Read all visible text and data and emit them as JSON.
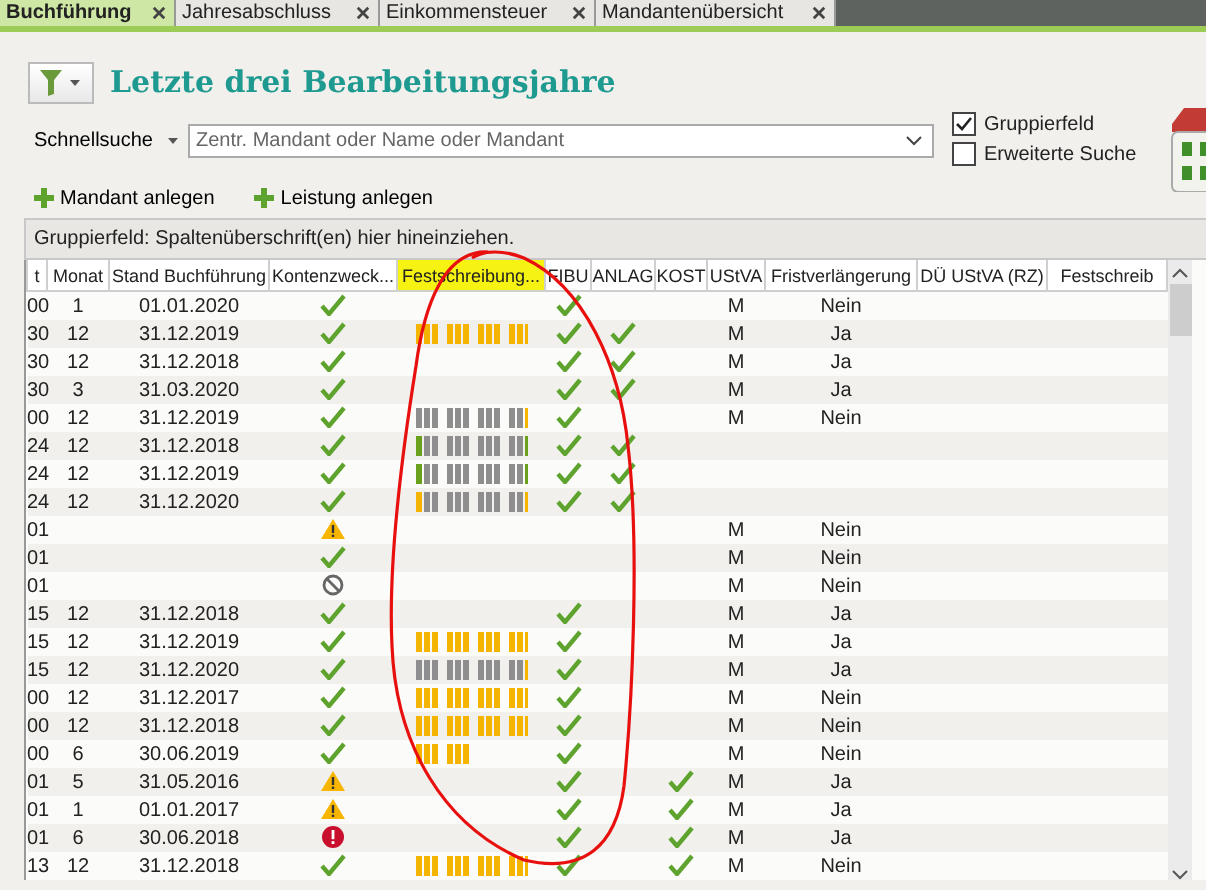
{
  "tabs": [
    {
      "label": "Buchführung",
      "selected": true
    },
    {
      "label": "Jahresabschluss",
      "selected": false
    },
    {
      "label": "Einkommensteuer",
      "selected": false
    },
    {
      "label": "Mandantenübersicht",
      "selected": false
    }
  ],
  "title": "Letzte drei Bearbeitungsjahre",
  "search": {
    "label": "Schnellsuche",
    "placeholder": "Zentr. Mandant oder Name oder Mandant"
  },
  "options": [
    {
      "label": "Gruppierfeld",
      "checked": true
    },
    {
      "label": "Erweiterte Suche",
      "checked": false
    }
  ],
  "actions": [
    "Mandant anlegen",
    "Leistung anlegen"
  ],
  "group_panel": "Gruppierfeld: Spaltenüberschrift(en) hier hineinziehen.",
  "columns": [
    {
      "label": "t",
      "highlighted": false
    },
    {
      "label": "Monat",
      "highlighted": false
    },
    {
      "label": "Stand Buchführung",
      "highlighted": false
    },
    {
      "label": "Kontenzweck...",
      "highlighted": false
    },
    {
      "label": "Festschreibung...",
      "highlighted": true
    },
    {
      "label": "FIBU",
      "highlighted": false
    },
    {
      "label": "ANLAG",
      "highlighted": false
    },
    {
      "label": "KOST",
      "highlighted": false
    },
    {
      "label": "UStVA",
      "highlighted": false
    },
    {
      "label": "Fristverlängerung",
      "highlighted": false
    },
    {
      "label": "DÜ UStVA (RZ)",
      "highlighted": false
    },
    {
      "label": "Festschreib",
      "highlighted": false
    }
  ],
  "rows": [
    {
      "c0": "00",
      "monat": "1",
      "stand": "01.01.2020",
      "konten": {
        "kind": "check"
      },
      "fibu": true,
      "anlag": false,
      "kost": false,
      "ustva": "M",
      "frist": "Nein"
    },
    {
      "c0": "30",
      "monat": "12",
      "stand": "31.12.2019",
      "konten": {
        "kind": "check"
      },
      "bars": [
        {
          "kind": "open"
        },
        {
          "kind": "open"
        },
        {
          "kind": "open"
        },
        {
          "kind": "open"
        },
        {
          "kind": "open"
        },
        {
          "kind": "open"
        },
        {
          "kind": "open"
        },
        {
          "kind": "open"
        },
        {
          "kind": "open"
        },
        {
          "kind": "open"
        },
        {
          "kind": "open"
        },
        {
          "kind": "open"
        }
      ],
      "fibu": true,
      "anlag": true,
      "kost": false,
      "ustva": "M",
      "frist": "Ja"
    },
    {
      "c0": "30",
      "monat": "12",
      "stand": "31.12.2018",
      "konten": {
        "kind": "check"
      },
      "fibu": true,
      "anlag": true,
      "kost": false,
      "ustva": "M",
      "frist": "Ja"
    },
    {
      "c0": "30",
      "monat": "3",
      "stand": "31.03.2020",
      "konten": {
        "kind": "check"
      },
      "fibu": true,
      "anlag": true,
      "kost": false,
      "ustva": "M",
      "frist": "Ja"
    },
    {
      "c0": "00",
      "monat": "12",
      "stand": "31.12.2019",
      "konten": {
        "kind": "check"
      },
      "bars": [
        {
          "kind": "locked"
        },
        {
          "kind": "locked"
        },
        {
          "kind": "locked"
        },
        {
          "kind": "locked"
        },
        {
          "kind": "locked"
        },
        {
          "kind": "locked"
        },
        {
          "kind": "locked"
        },
        {
          "kind": "locked"
        },
        {
          "kind": "locked"
        },
        {
          "kind": "locked"
        },
        {
          "kind": "locked"
        },
        {
          "kind": "open"
        }
      ],
      "fibu": true,
      "anlag": false,
      "kost": false,
      "ustva": "M",
      "frist": "Nein"
    },
    {
      "c0": "24",
      "monat": "12",
      "stand": "31.12.2018",
      "konten": {
        "kind": "check"
      },
      "bars": [
        {
          "kind": "done"
        },
        {
          "kind": "locked"
        },
        {
          "kind": "locked"
        },
        {
          "kind": "locked"
        },
        {
          "kind": "locked"
        },
        {
          "kind": "locked"
        },
        {
          "kind": "locked"
        },
        {
          "kind": "locked"
        },
        {
          "kind": "locked"
        },
        {
          "kind": "locked"
        },
        {
          "kind": "locked"
        },
        {
          "kind": "done"
        }
      ],
      "fibu": true,
      "anlag": true,
      "kost": false
    },
    {
      "c0": "24",
      "monat": "12",
      "stand": "31.12.2019",
      "konten": {
        "kind": "check"
      },
      "bars": [
        {
          "kind": "done"
        },
        {
          "kind": "locked"
        },
        {
          "kind": "locked"
        },
        {
          "kind": "locked"
        },
        {
          "kind": "locked"
        },
        {
          "kind": "locked"
        },
        {
          "kind": "locked"
        },
        {
          "kind": "locked"
        },
        {
          "kind": "locked"
        },
        {
          "kind": "locked"
        },
        {
          "kind": "locked"
        },
        {
          "kind": "done"
        }
      ],
      "fibu": true,
      "anlag": true,
      "kost": false
    },
    {
      "c0": "24",
      "monat": "12",
      "stand": "31.12.2020",
      "konten": {
        "kind": "check"
      },
      "bars": [
        {
          "kind": "open"
        },
        {
          "kind": "locked"
        },
        {
          "kind": "locked"
        },
        {
          "kind": "locked"
        },
        {
          "kind": "locked"
        },
        {
          "kind": "locked"
        },
        {
          "kind": "locked"
        },
        {
          "kind": "locked"
        },
        {
          "kind": "locked"
        },
        {
          "kind": "locked"
        },
        {
          "kind": "locked"
        },
        {
          "kind": "open"
        }
      ],
      "fibu": true,
      "anlag": true,
      "kost": false
    },
    {
      "c0": "01",
      "konten": {
        "kind": "warning"
      },
      "fibu": false,
      "anlag": false,
      "kost": false,
      "ustva": "M",
      "frist": "Nein"
    },
    {
      "c0": "01",
      "konten": {
        "kind": "check"
      },
      "fibu": false,
      "anlag": false,
      "kost": false,
      "ustva": "M",
      "frist": "Nein"
    },
    {
      "c0": "01",
      "konten": {
        "kind": "blocked"
      },
      "fibu": false,
      "anlag": false,
      "kost": false,
      "ustva": "M",
      "frist": "Nein"
    },
    {
      "c0": "15",
      "monat": "12",
      "stand": "31.12.2018",
      "konten": {
        "kind": "check"
      },
      "fibu": true,
      "anlag": false,
      "kost": false,
      "ustva": "M",
      "frist": "Ja"
    },
    {
      "c0": "15",
      "monat": "12",
      "stand": "31.12.2019",
      "konten": {
        "kind": "check"
      },
      "bars": [
        {
          "kind": "open"
        },
        {
          "kind": "open"
        },
        {
          "kind": "open"
        },
        {
          "kind": "open"
        },
        {
          "kind": "open"
        },
        {
          "kind": "open"
        },
        {
          "kind": "open"
        },
        {
          "kind": "open"
        },
        {
          "kind": "open"
        },
        {
          "kind": "open"
        },
        {
          "kind": "open"
        },
        {
          "kind": "open"
        }
      ],
      "fibu": true,
      "anlag": false,
      "kost": false,
      "ustva": "M",
      "frist": "Ja"
    },
    {
      "c0": "15",
      "monat": "12",
      "stand": "31.12.2020",
      "konten": {
        "kind": "check"
      },
      "bars": [
        {
          "kind": "locked"
        },
        {
          "kind": "locked"
        },
        {
          "kind": "locked"
        },
        {
          "kind": "locked"
        },
        {
          "kind": "locked"
        },
        {
          "kind": "locked"
        },
        {
          "kind": "locked"
        },
        {
          "kind": "locked"
        },
        {
          "kind": "locked"
        },
        {
          "kind": "locked"
        },
        {
          "kind": "locked"
        },
        {
          "kind": "open"
        }
      ],
      "fibu": true,
      "anlag": false,
      "kost": false,
      "ustva": "M",
      "frist": "Ja"
    },
    {
      "c0": "00",
      "monat": "12",
      "stand": "31.12.2017",
      "konten": {
        "kind": "check"
      },
      "bars": [
        {
          "kind": "open"
        },
        {
          "kind": "open"
        },
        {
          "kind": "open"
        },
        {
          "kind": "open"
        },
        {
          "kind": "open"
        },
        {
          "kind": "open"
        },
        {
          "kind": "open"
        },
        {
          "kind": "open"
        },
        {
          "kind": "open"
        },
        {
          "kind": "open"
        },
        {
          "kind": "open"
        },
        {
          "kind": "open"
        }
      ],
      "fibu": true,
      "anlag": false,
      "kost": false,
      "ustva": "M",
      "frist": "Nein"
    },
    {
      "c0": "00",
      "monat": "12",
      "stand": "31.12.2018",
      "konten": {
        "kind": "check"
      },
      "bars": [
        {
          "kind": "open"
        },
        {
          "kind": "open"
        },
        {
          "kind": "open"
        },
        {
          "kind": "open"
        },
        {
          "kind": "open"
        },
        {
          "kind": "open"
        },
        {
          "kind": "open"
        },
        {
          "kind": "open"
        },
        {
          "kind": "open"
        },
        {
          "kind": "open"
        },
        {
          "kind": "open"
        },
        {
          "kind": "open"
        }
      ],
      "fibu": true,
      "anlag": false,
      "kost": false,
      "ustva": "M",
      "frist": "Nein"
    },
    {
      "c0": "00",
      "monat": "6",
      "stand": "30.06.2019",
      "konten": {
        "kind": "check"
      },
      "bars": [
        {
          "kind": "open"
        },
        {
          "kind": "open"
        },
        {
          "kind": "open"
        },
        {
          "kind": "open"
        },
        {
          "kind": "open"
        },
        {
          "kind": "open"
        }
      ],
      "fibu": true,
      "anlag": false,
      "kost": false,
      "ustva": "M",
      "frist": "Nein"
    },
    {
      "c0": "01",
      "monat": "5",
      "stand": "31.05.2016",
      "konten": {
        "kind": "warning"
      },
      "fibu": true,
      "anlag": false,
      "kost": true,
      "ustva": "M",
      "frist": "Ja"
    },
    {
      "c0": "01",
      "monat": "1",
      "stand": "01.01.2017",
      "konten": {
        "kind": "warning"
      },
      "fibu": true,
      "anlag": false,
      "kost": true,
      "ustva": "M",
      "frist": "Ja"
    },
    {
      "c0": "01",
      "monat": "6",
      "stand": "30.06.2018",
      "konten": {
        "kind": "error"
      },
      "fibu": true,
      "anlag": false,
      "kost": true,
      "ustva": "M",
      "frist": "Ja"
    },
    {
      "c0": "13",
      "monat": "12",
      "stand": "31.12.2018",
      "konten": {
        "kind": "check"
      },
      "bars": [
        {
          "kind": "open"
        },
        {
          "kind": "open"
        },
        {
          "kind": "open"
        },
        {
          "kind": "open"
        },
        {
          "kind": "open"
        },
        {
          "kind": "open"
        },
        {
          "kind": "open"
        },
        {
          "kind": "open"
        },
        {
          "kind": "open"
        },
        {
          "kind": "open"
        },
        {
          "kind": "open"
        },
        {
          "kind": "open"
        }
      ],
      "fibu": true,
      "anlag": false,
      "kost": true,
      "ustva": "M",
      "frist": "Nein"
    }
  ]
}
